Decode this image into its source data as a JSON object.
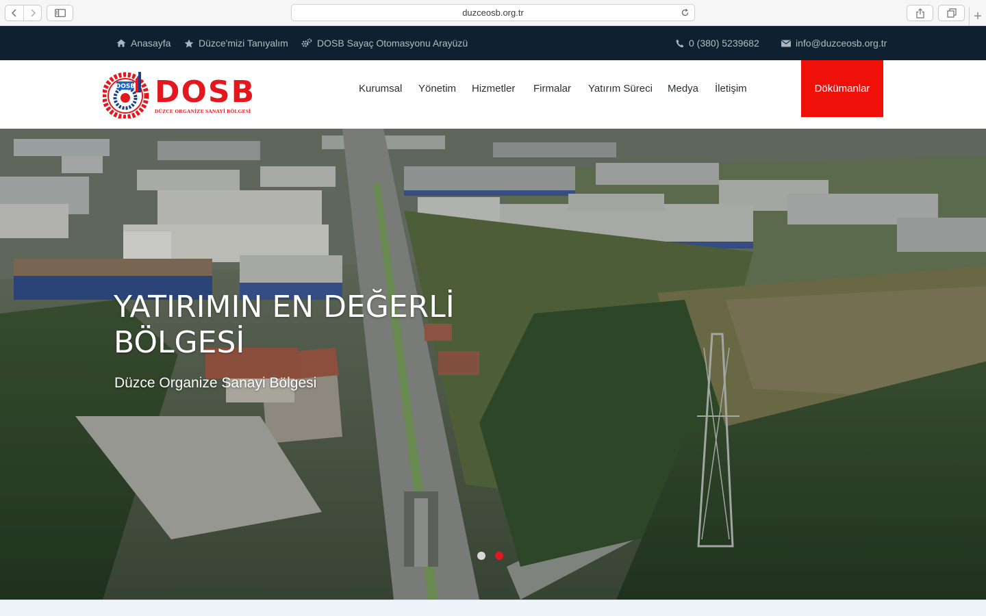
{
  "browser": {
    "url": "duzceosb.org.tr",
    "back_icon": "chevron-left-icon",
    "forward_icon": "chevron-right-icon",
    "sidebar_icon": "sidebar-icon",
    "reload_icon": "reload-icon",
    "share_icon": "share-icon",
    "tabs_icon": "tabs-icon",
    "new_tab_label": "+"
  },
  "topbar": {
    "links": [
      {
        "label": "Anasayfa",
        "icon": "home-icon"
      },
      {
        "label": "Düzce'mizi Tanıyalım",
        "icon": "star-icon"
      },
      {
        "label": "DOSB Sayaç Otomasyonu Arayüzü",
        "icon": "gears-icon"
      }
    ],
    "phone": {
      "label": "0 (380) 5239682",
      "icon": "phone-icon"
    },
    "email": {
      "label": "info@duzceosb.org.tr",
      "icon": "envelope-icon"
    },
    "background": "#0f2131"
  },
  "header": {
    "logo": {
      "badge": "DOSB",
      "name": "DOSB",
      "subtitle": "DÜZCE ORGANİZE SANAYİ BÖLGESİ"
    },
    "nav": [
      {
        "label": "Kurumsal"
      },
      {
        "label": "Yönetim"
      },
      {
        "label": "Hizmetler"
      },
      {
        "label": "Firmalar"
      },
      {
        "label": "Yatırım Süreci"
      },
      {
        "label": "Medya"
      },
      {
        "label": "İletişim"
      }
    ],
    "cta": {
      "label": "Dökümanlar",
      "color": "#f0100a"
    }
  },
  "hero": {
    "title": "YATIRIMIN EN DEĞERLİ BÖLGESİ",
    "subtitle": "Düzce Organize Sanayi Bölgesi",
    "slides": 2,
    "active_slide": 2,
    "dot_active_color": "#e3171e"
  }
}
